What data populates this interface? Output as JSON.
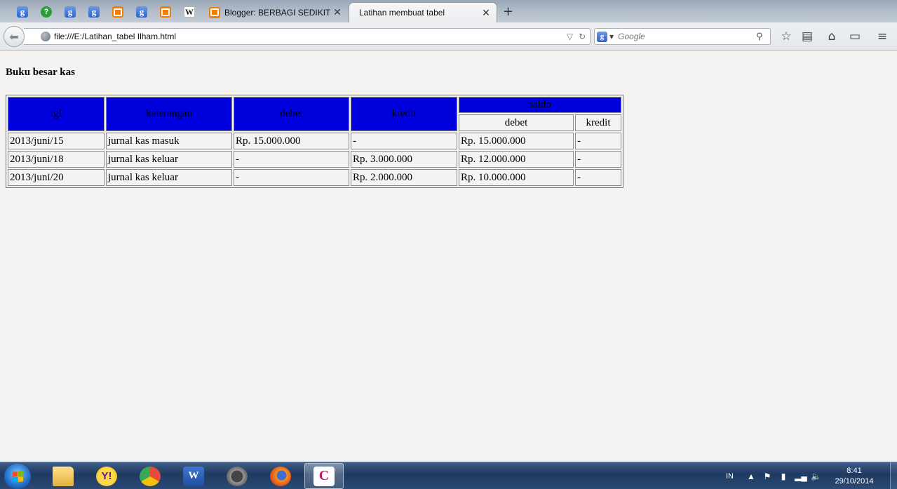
{
  "browser": {
    "pinned_tabs": [
      {
        "icon": "google-icon",
        "glyph": "g"
      },
      {
        "icon": "help-icon",
        "glyph": "?"
      },
      {
        "icon": "google-icon",
        "glyph": "g"
      },
      {
        "icon": "google-icon",
        "glyph": "g"
      },
      {
        "icon": "blogger-icon",
        "glyph": ""
      },
      {
        "icon": "google-icon",
        "glyph": "g"
      },
      {
        "icon": "blogger-icon",
        "glyph": ""
      },
      {
        "icon": "wikipedia-icon",
        "glyph": "W"
      }
    ],
    "tabs": [
      {
        "label": "Blogger: BERBAGI SEDIKIT :...",
        "icon": "blogger-icon",
        "active": false
      },
      {
        "label": "Latihan membuat tabel",
        "active": true
      }
    ],
    "new_tab_glyph": "+",
    "address": "file:///E:/Latihan_tabel Ilham.html",
    "search_placeholder": "Google"
  },
  "page": {
    "heading": "Buku besar kas",
    "table": {
      "headers": {
        "tgl": "tgl",
        "keterangan": "keterangan",
        "debet": "debet",
        "kredit": "kredit",
        "saldo": "saldo",
        "saldo_debet": "debet",
        "saldo_kredit": "kredit"
      },
      "rows": [
        [
          "2013/juni/15",
          "jurnal kas masuk",
          "Rp. 15.000.000",
          "-",
          "Rp. 15.000.000",
          "-"
        ],
        [
          "2013/juni/18",
          "jurnal kas keluar",
          "-",
          "Rp. 3.000.000",
          "Rp. 12.000.000",
          "-"
        ],
        [
          "2013/juni/20",
          "jurnal kas keluar",
          "-",
          "Rp. 2.000.000",
          "Rp. 10.000.000",
          "-"
        ]
      ],
      "header_color": "#0000dd"
    }
  },
  "taskbar": {
    "apps": [
      "file-explorer",
      "yahoo-messenger",
      "chrome",
      "microsoft-word",
      "media-player",
      "firefox",
      "coreldraw"
    ],
    "active_app": "coreldraw",
    "language": "IN",
    "time": "8:41",
    "date": "29/10/2014"
  }
}
